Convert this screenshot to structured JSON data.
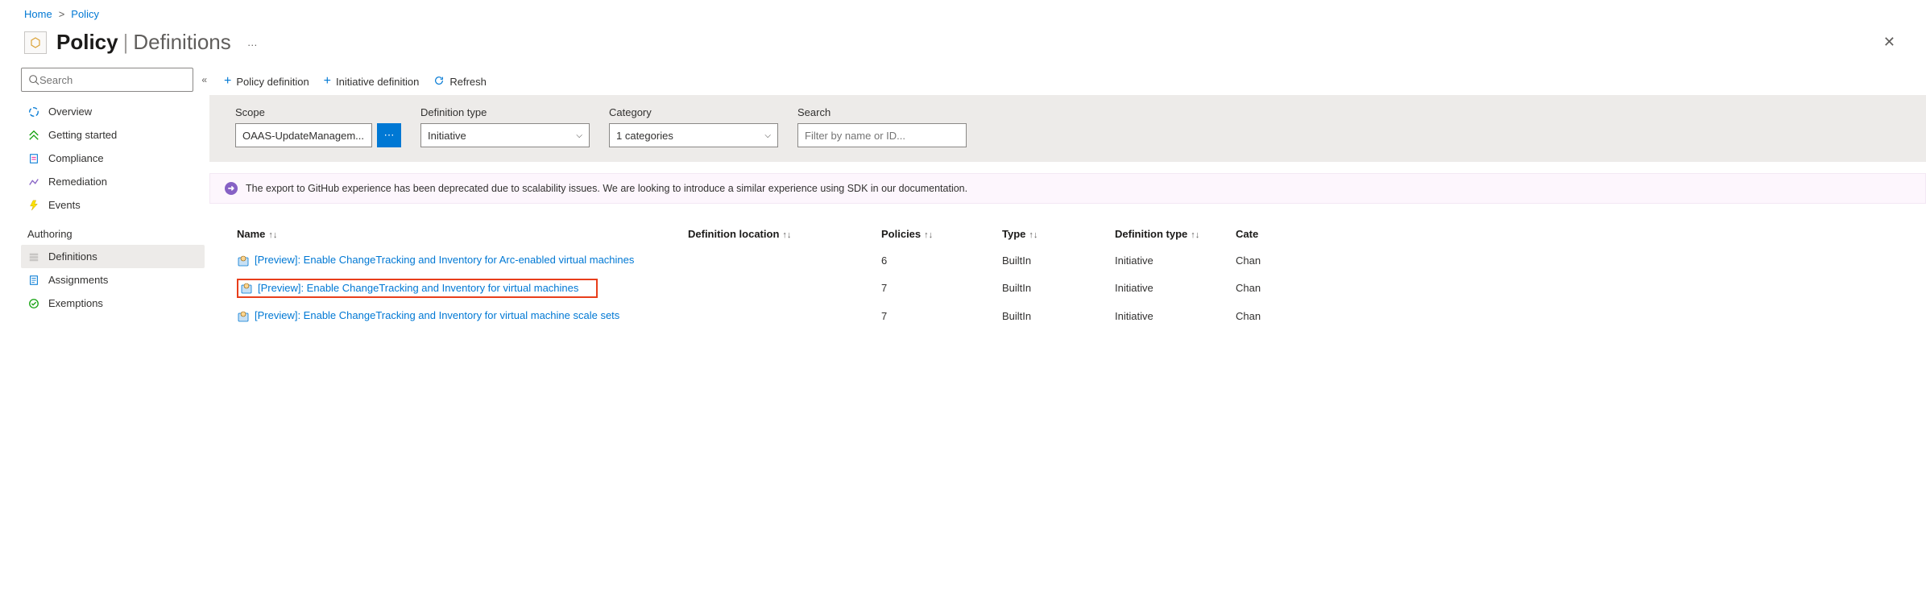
{
  "breadcrumb": {
    "home": "Home",
    "policy": "Policy"
  },
  "header": {
    "title": "Policy",
    "subtitle": "Definitions",
    "dots": "…"
  },
  "sidebar": {
    "search_placeholder": "Search",
    "items": {
      "overview": "Overview",
      "getting_started": "Getting started",
      "compliance": "Compliance",
      "remediation": "Remediation",
      "events": "Events"
    },
    "group_authoring": "Authoring",
    "authoring": {
      "definitions": "Definitions",
      "assignments": "Assignments",
      "exemptions": "Exemptions"
    }
  },
  "toolbar": {
    "policy_definition": "Policy definition",
    "initiative_definition": "Initiative definition",
    "refresh": "Refresh"
  },
  "filters": {
    "scope_label": "Scope",
    "scope_value": "OAAS-UpdateManagem...",
    "definition_type_label": "Definition type",
    "definition_type_value": "Initiative",
    "category_label": "Category",
    "category_value": "1 categories",
    "search_label": "Search",
    "search_placeholder": "Filter by name or ID..."
  },
  "banner": {
    "text": "The export to GitHub experience has been deprecated due to scalability issues. We are looking to introduce a similar experience using SDK in our documentation."
  },
  "table": {
    "headers": {
      "name": "Name",
      "definition_location": "Definition location",
      "policies": "Policies",
      "type": "Type",
      "definition_type": "Definition type",
      "category": "Cate"
    },
    "rows": [
      {
        "name": "[Preview]: Enable ChangeTracking and Inventory for Arc-enabled virtual machines",
        "location": "",
        "policies": "6",
        "type": "BuiltIn",
        "def_type": "Initiative",
        "category": "Chan",
        "highlight": false
      },
      {
        "name": "[Preview]: Enable ChangeTracking and Inventory for virtual machines",
        "location": "",
        "policies": "7",
        "type": "BuiltIn",
        "def_type": "Initiative",
        "category": "Chan",
        "highlight": true
      },
      {
        "name": "[Preview]: Enable ChangeTracking and Inventory for virtual machine scale sets",
        "location": "",
        "policies": "7",
        "type": "BuiltIn",
        "def_type": "Initiative",
        "category": "Chan",
        "highlight": false
      }
    ]
  }
}
